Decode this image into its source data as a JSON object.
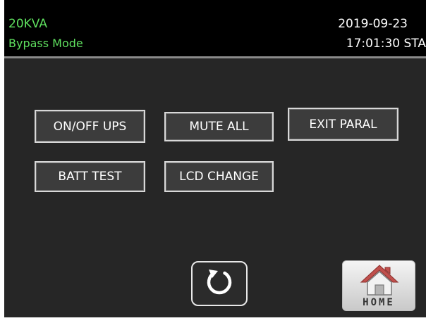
{
  "header": {
    "model": "20KVA",
    "mode": "Bypass Mode",
    "date": "2019-09-23",
    "time": "17:01:30 STA"
  },
  "buttons": {
    "onoff_ups": "ON/OFF UPS",
    "mute_all": "MUTE ALL",
    "exit_paral": "EXIT PARAL",
    "batt_test": "BATT TEST",
    "lcd_change": "LCD CHANGE"
  },
  "nav": {
    "back_icon": "refresh-icon",
    "home_icon": "home-icon",
    "home_label": "HOME"
  },
  "colors": {
    "status_text": "#5fe05f",
    "background": "#262626",
    "header_bg": "#000000",
    "home_roof": "#c0504d"
  }
}
